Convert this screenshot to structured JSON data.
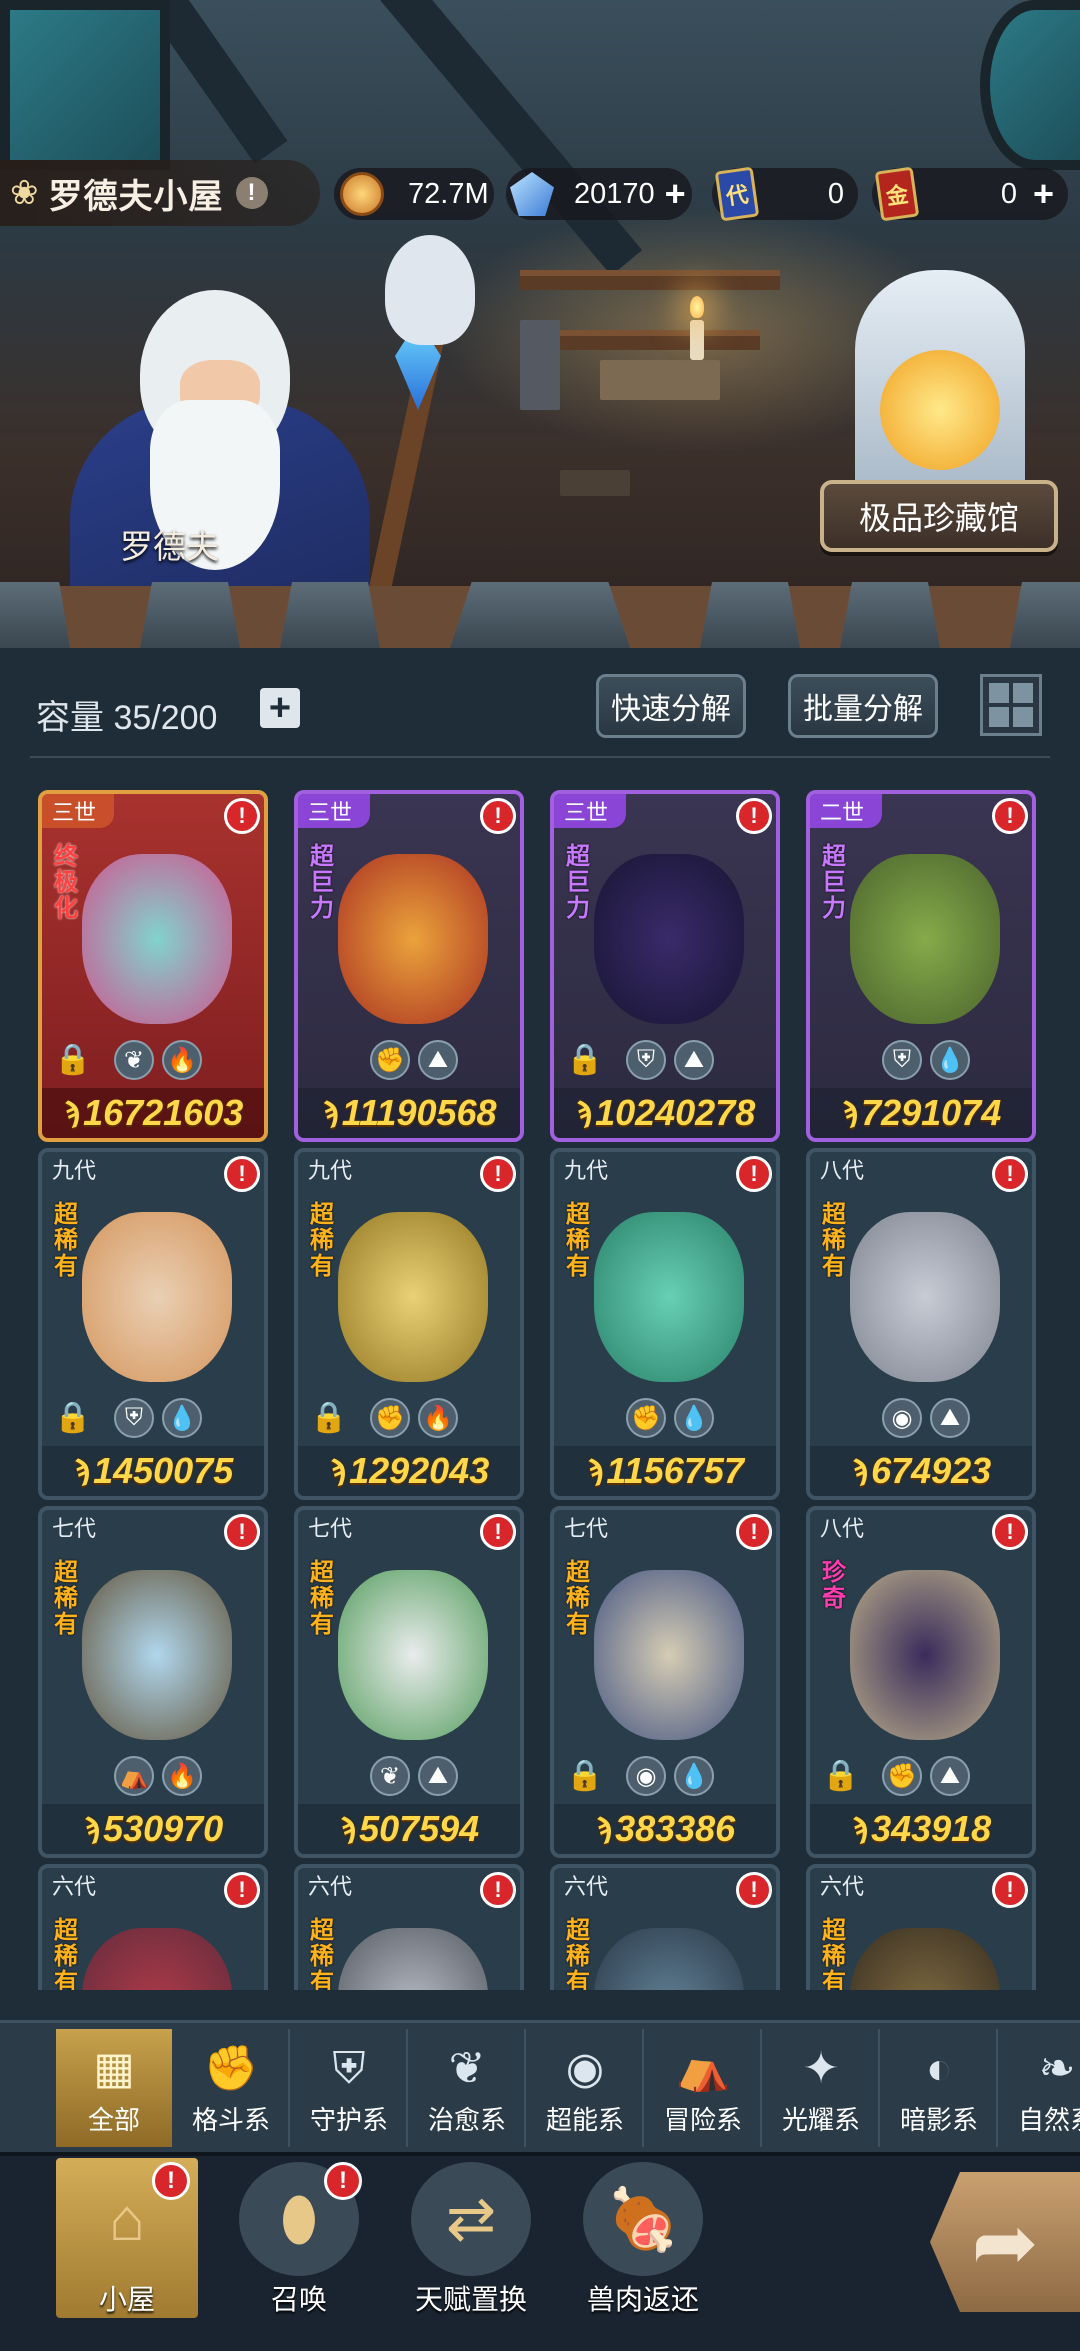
{
  "header": {
    "house_name": "罗德夫小屋",
    "info_glyph": "!",
    "paw_icon": "paw-icon"
  },
  "currencies": [
    {
      "icon": "coin-icon",
      "value": "72.7M",
      "has_plus": false
    },
    {
      "icon": "crystal-icon",
      "value": "20170",
      "has_plus": true
    },
    {
      "icon": "card-ticket-icon",
      "glyph": "代",
      "value": "0",
      "has_plus": false
    },
    {
      "icon": "gold-ticket-icon",
      "glyph": "金",
      "value": "0",
      "has_plus": true
    }
  ],
  "plus_glyph": "+",
  "scene": {
    "npc_name": "罗德夫",
    "museum_label": "极品珍藏馆"
  },
  "storage": {
    "capacity_label": "容量 35/200",
    "add_glyph": "+",
    "quick_decompose": "快速分解",
    "batch_decompose": "批量分解"
  },
  "cards": [
    {
      "gen": "三世",
      "rarity": "终极化",
      "power": "16721603",
      "locked": true,
      "elements": [
        "leaf-icon",
        "fire-icon"
      ],
      "style": "red"
    },
    {
      "gen": "三世",
      "rarity": "超巨力",
      "power": "11190568",
      "locked": false,
      "elements": [
        "fist-icon",
        "earth-icon"
      ],
      "style": "purple"
    },
    {
      "gen": "三世",
      "rarity": "超巨力",
      "power": "10240278",
      "locked": true,
      "elements": [
        "shield-icon",
        "earth-icon"
      ],
      "style": "purple"
    },
    {
      "gen": "二世",
      "rarity": "超巨力",
      "power": "7291074",
      "locked": false,
      "elements": [
        "shield-icon",
        "water-icon"
      ],
      "style": "purple"
    },
    {
      "gen": "九代",
      "rarity": "超稀有",
      "power": "1450075",
      "locked": true,
      "elements": [
        "shield-icon",
        "water-icon"
      ],
      "style": "plain"
    },
    {
      "gen": "九代",
      "rarity": "超稀有",
      "power": "1292043",
      "locked": true,
      "elements": [
        "fist-icon",
        "fire-icon"
      ],
      "style": "plain"
    },
    {
      "gen": "九代",
      "rarity": "超稀有",
      "power": "1156757",
      "locked": false,
      "elements": [
        "fist-icon",
        "water-icon"
      ],
      "style": "plain"
    },
    {
      "gen": "八代",
      "rarity": "超稀有",
      "power": "674923",
      "locked": false,
      "elements": [
        "psychic-icon",
        "earth-icon"
      ],
      "style": "plain"
    },
    {
      "gen": "七代",
      "rarity": "超稀有",
      "power": "530970",
      "locked": false,
      "elements": [
        "adventure-icon",
        "fire-icon"
      ],
      "style": "plain"
    },
    {
      "gen": "七代",
      "rarity": "超稀有",
      "power": "507594",
      "locked": false,
      "elements": [
        "leaf-icon",
        "earth-icon"
      ],
      "style": "plain"
    },
    {
      "gen": "七代",
      "rarity": "超稀有",
      "power": "383386",
      "locked": true,
      "elements": [
        "psychic-icon",
        "water-icon"
      ],
      "style": "plain"
    },
    {
      "gen": "八代",
      "rarity": "珍奇",
      "power": "343918",
      "locked": true,
      "elements": [
        "fist-icon",
        "earth-icon"
      ],
      "style": "plain"
    },
    {
      "gen": "六代",
      "rarity": "超稀有",
      "power": "",
      "locked": false,
      "elements": [],
      "style": "plain"
    },
    {
      "gen": "六代",
      "rarity": "超稀有",
      "power": "",
      "locked": false,
      "elements": [],
      "style": "plain"
    },
    {
      "gen": "六代",
      "rarity": "超稀有",
      "power": "",
      "locked": false,
      "elements": [],
      "style": "plain"
    },
    {
      "gen": "六代",
      "rarity": "超稀有",
      "power": "",
      "locked": false,
      "elements": [],
      "style": "plain"
    }
  ],
  "categories": [
    {
      "label": "全部",
      "icon": "all-icon",
      "active": true
    },
    {
      "label": "格斗系",
      "icon": "fist-icon"
    },
    {
      "label": "守护系",
      "icon": "shield-icon"
    },
    {
      "label": "治愈系",
      "icon": "leaf-icon"
    },
    {
      "label": "超能系",
      "icon": "psychic-icon"
    },
    {
      "label": "冒险系",
      "icon": "adventure-icon"
    },
    {
      "label": "光耀系",
      "icon": "light-icon"
    },
    {
      "label": "暗影系",
      "icon": "shadow-icon"
    },
    {
      "label": "自然系",
      "icon": "nature-icon"
    }
  ],
  "bottom_nav": [
    {
      "label": "小屋",
      "icon": "house-icon",
      "active": true,
      "alert": true
    },
    {
      "label": "召唤",
      "icon": "egg-icon",
      "alert": true
    },
    {
      "label": "天赋置换",
      "icon": "swap-icon"
    },
    {
      "label": "兽肉返还",
      "icon": "meat-icon"
    }
  ],
  "go_icon": "arrow-forward-icon",
  "colors": {
    "accent_gold": "#ffd84a",
    "alert_red": "#d8262a",
    "panel_bg": "#1f2d38"
  }
}
